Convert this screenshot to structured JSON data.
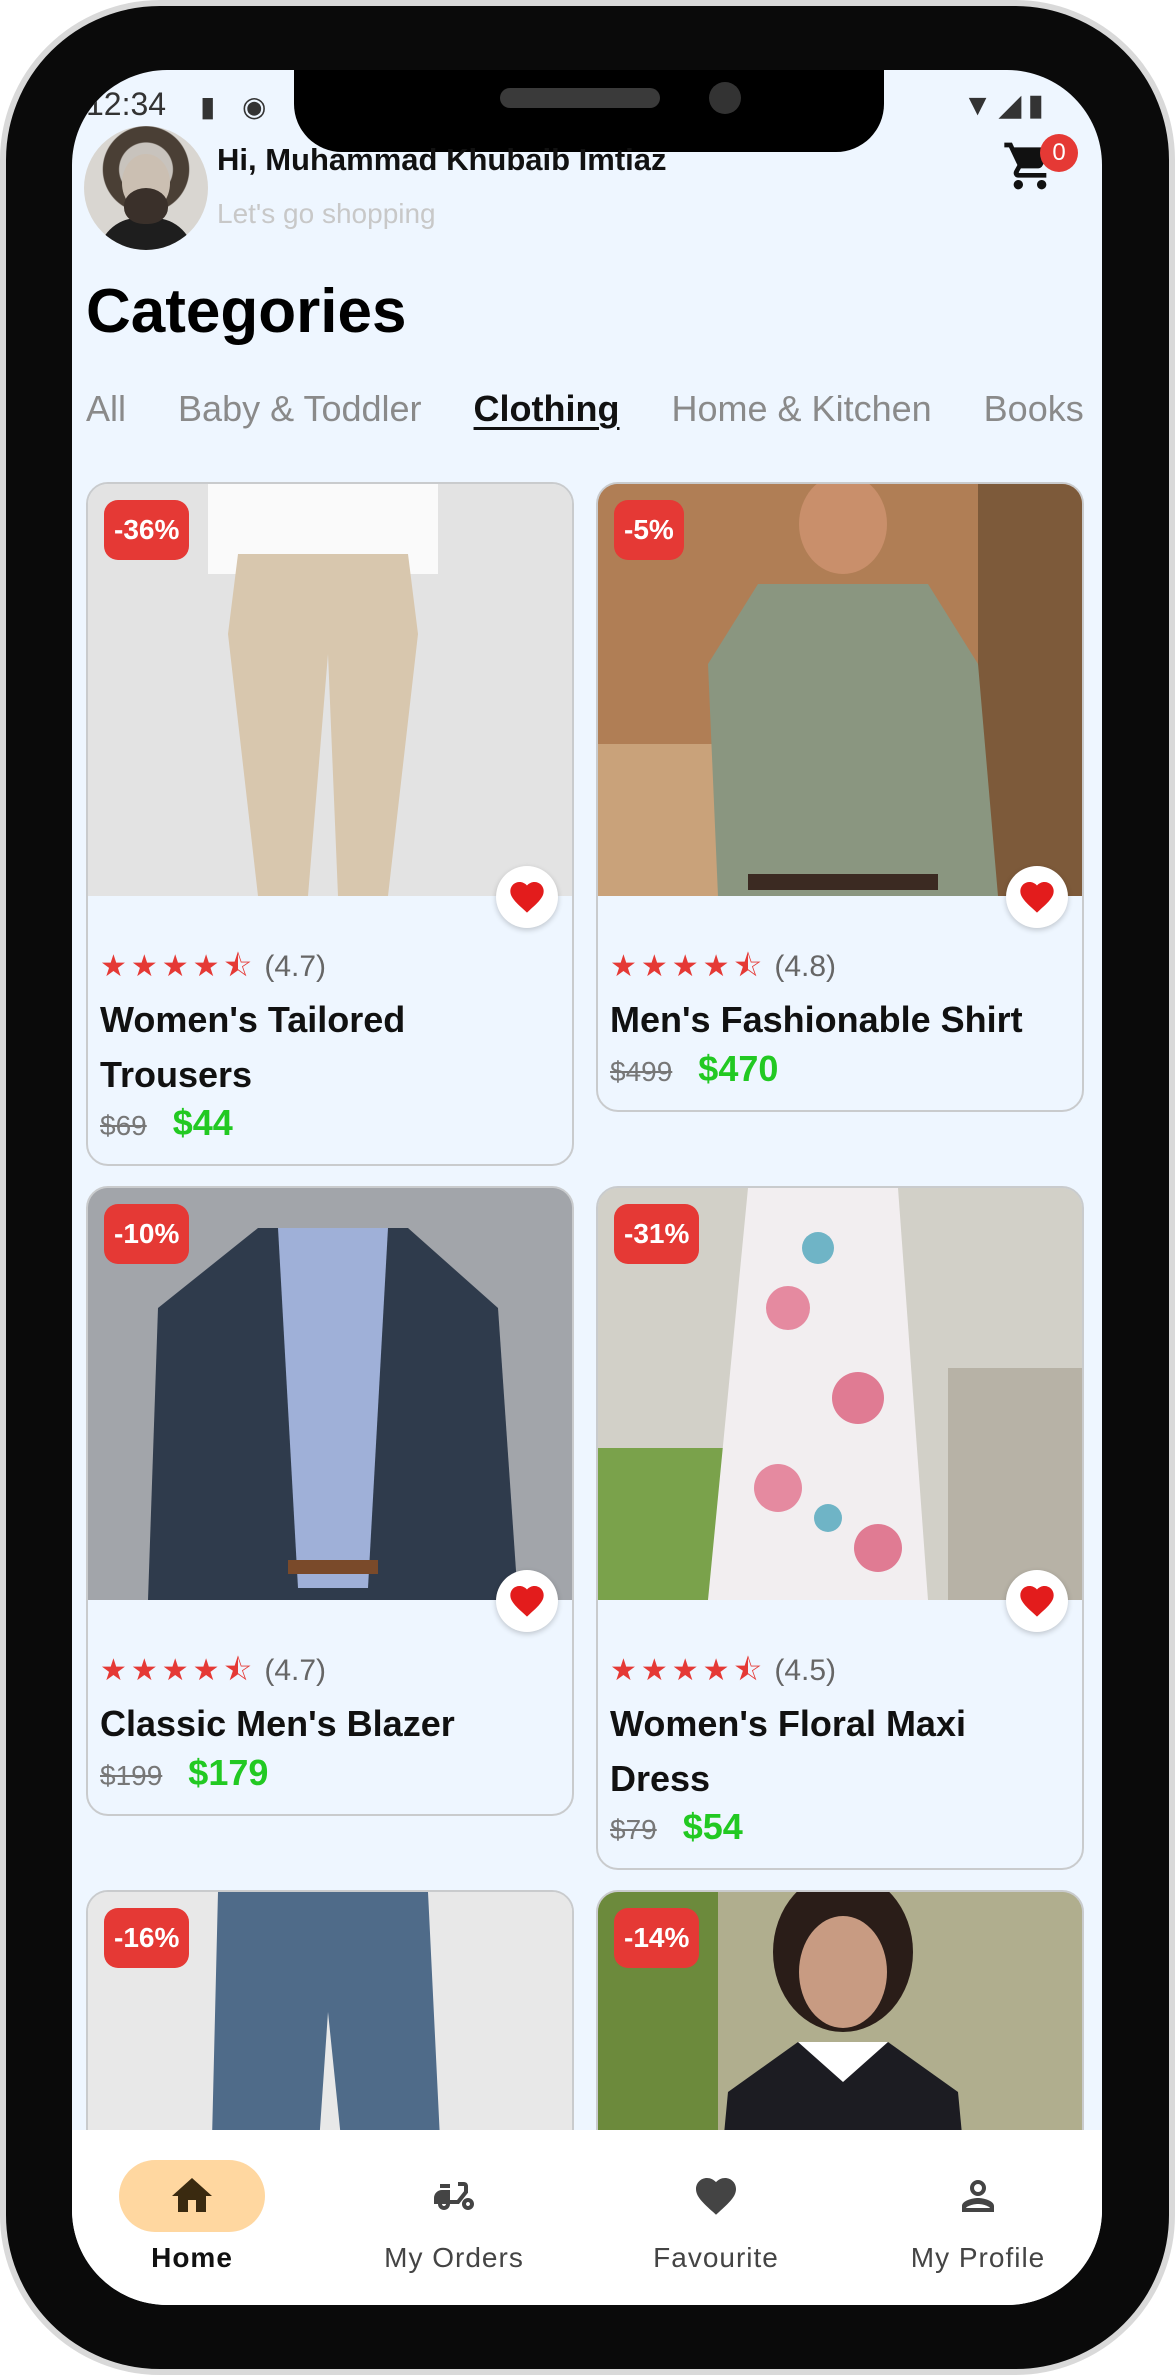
{
  "status": {
    "time": "12:34"
  },
  "header": {
    "greeting": "Hi, Muhammad Khubaib Imtiaz",
    "subtitle": "Let's go shopping",
    "cart_count": "0"
  },
  "categories": {
    "title": "Categories",
    "tabs": [
      "All",
      "Baby & Toddler",
      "Clothing",
      "Home & Kitchen",
      "Books"
    ],
    "active": "Clothing"
  },
  "products": [
    {
      "discount": "-36%",
      "stars": "★★★★⯪",
      "rating": "(4.7)",
      "name": "Women's Tailored Trousers",
      "old_price": "$69",
      "price": "$44"
    },
    {
      "discount": "-5%",
      "stars": "★★★★⯪",
      "rating": "(4.8)",
      "name": "Men's Fashionable Shirt",
      "old_price": "$499",
      "price": "$470"
    },
    {
      "discount": "-10%",
      "stars": "★★★★⯪",
      "rating": "(4.7)",
      "name": "Classic Men's Blazer",
      "old_price": "$199",
      "price": "$179"
    },
    {
      "discount": "-31%",
      "stars": "★★★★⯪",
      "rating": "(4.5)",
      "name": "Women's Floral Maxi Dress",
      "old_price": "$79",
      "price": "$54"
    },
    {
      "discount": "-16%"
    },
    {
      "discount": "-14%"
    }
  ],
  "nav": [
    {
      "label": "Home",
      "icon": "home-icon",
      "active": true
    },
    {
      "label": "My Orders",
      "icon": "scooter-icon",
      "active": false
    },
    {
      "label": "Favourite",
      "icon": "heart-icon",
      "active": false
    },
    {
      "label": "My Profile",
      "icon": "person-icon",
      "active": false
    }
  ],
  "colors": {
    "accent": "#e53935",
    "price": "#22c922",
    "nav_active": "#ffd7a0",
    "background": "#eef6ff"
  }
}
